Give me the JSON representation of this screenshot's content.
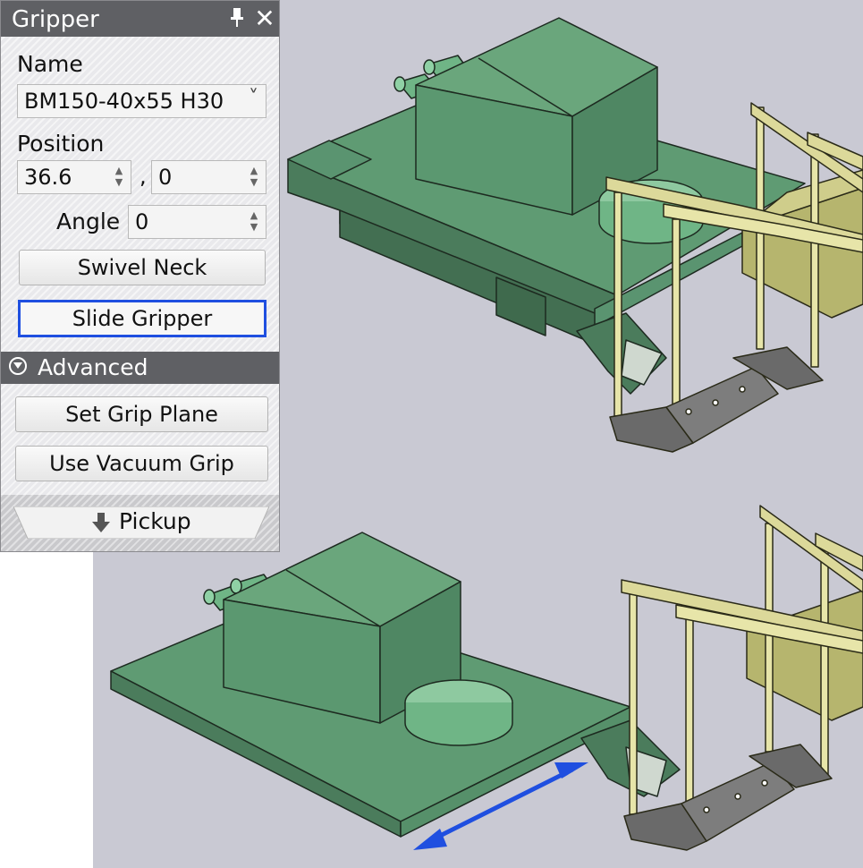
{
  "panel": {
    "title": "Gripper",
    "pin_icon": "pin-icon",
    "close_icon": "close-icon",
    "name_label": "Name",
    "name_value": "BM150-40x55 H30",
    "position_label": "Position",
    "position_x": "36.6",
    "position_separator": ",",
    "position_y": "0",
    "angle_label": "Angle",
    "angle_value": "0",
    "swivel_neck_label": "Swivel Neck",
    "slide_gripper_label": "Slide Gripper",
    "advanced_label": "Advanced",
    "set_grip_plane_label": "Set Grip Plane",
    "use_vacuum_grip_label": "Use Vacuum Grip",
    "pickup_label": "Pickup"
  },
  "colors": {
    "panel_header": "#5f6064",
    "active_outline": "#1f4fe0",
    "viewport_bg": "#c9c9d3",
    "gripper_green": "#5c9a70",
    "fixture_yellow": "#d8d79a",
    "motion_arrow": "#1f4fe0"
  }
}
